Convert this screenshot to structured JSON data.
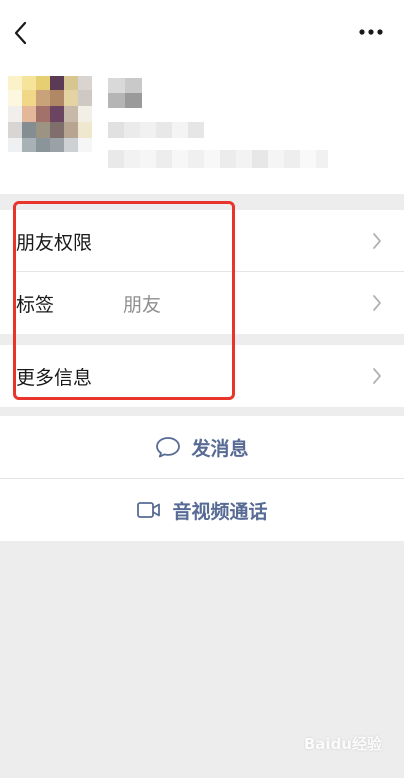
{
  "rows": {
    "permissions": {
      "label": "朋友权限"
    },
    "tag": {
      "label": "标签",
      "value": "朋友"
    },
    "more_info": {
      "label": "更多信息"
    }
  },
  "actions": {
    "send_message": {
      "label": "发消息",
      "icon": "chat-bubble-icon"
    },
    "av_call": {
      "label": "音视频通话",
      "icon": "video-camera-icon"
    }
  },
  "watermark": "Baidu经验",
  "colors": {
    "accent": "#576b95",
    "highlight": "#e8342a",
    "background": "#ededed"
  }
}
